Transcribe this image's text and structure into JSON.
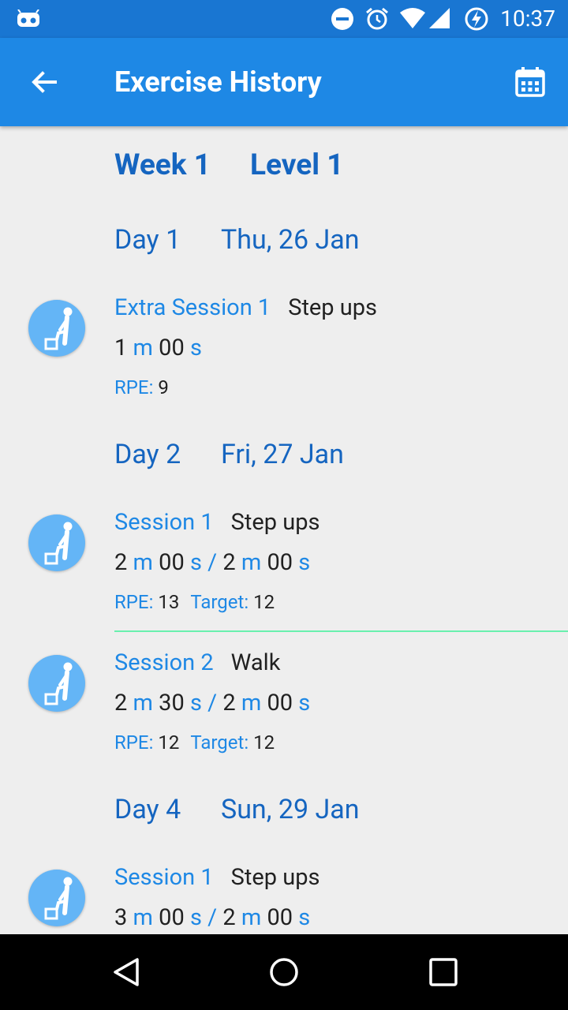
{
  "status_bar": {
    "time": "10:37",
    "icons": [
      "android-debug-icon",
      "do-not-disturb-icon",
      "alarm-icon",
      "wifi-icon",
      "cell-signal-icon",
      "battery-charging-icon"
    ]
  },
  "app_bar": {
    "title": "Exercise History",
    "back_icon": "arrow-back-icon",
    "calendar_icon": "calendar-icon"
  },
  "week": {
    "week_label": "Week 1",
    "level_label": "Level 1"
  },
  "days": [
    {
      "day_label": "Day 1",
      "date": "Thu, 26 Jan",
      "entries": [
        {
          "session": "Extra Session 1",
          "exercise": "Step ups",
          "actual": {
            "min": "1",
            "sec": "00"
          },
          "rpe_label": "RPE:",
          "rpe": "9"
        }
      ]
    },
    {
      "day_label": "Day 2",
      "date": "Fri, 27 Jan",
      "entries": [
        {
          "session": "Session 1",
          "exercise": "Step ups",
          "actual": {
            "min": "2",
            "sec": "00"
          },
          "target_time": {
            "min": "2",
            "sec": "00"
          },
          "rpe_label": "RPE:",
          "rpe": "13",
          "target_label": "Target:",
          "target": "12"
        },
        {
          "session": "Session 2",
          "exercise": "Walk",
          "actual": {
            "min": "2",
            "sec": "30"
          },
          "target_time": {
            "min": "2",
            "sec": "00"
          },
          "rpe_label": "RPE:",
          "rpe": "12",
          "target_label": "Target:",
          "target": "12"
        }
      ]
    },
    {
      "day_label": "Day 4",
      "date": "Sun, 29 Jan",
      "entries": [
        {
          "session": "Session 1",
          "exercise": "Step ups",
          "actual": {
            "min": "3",
            "sec": "00"
          },
          "target_time": {
            "min": "2",
            "sec": "00"
          }
        }
      ]
    }
  ],
  "units": {
    "minutes": "m",
    "seconds": "s",
    "separator": "/"
  },
  "colors": {
    "status_bar": "#1976d2",
    "app_bar": "#1e88e5",
    "accent_text": "#1e88e5",
    "header_text": "#1565c0",
    "avatar": "#64b5f6",
    "divider": "#69f0ae"
  },
  "nav_bar": {
    "icons": [
      "back-triangle-icon",
      "home-circle-icon",
      "recents-square-icon"
    ]
  }
}
